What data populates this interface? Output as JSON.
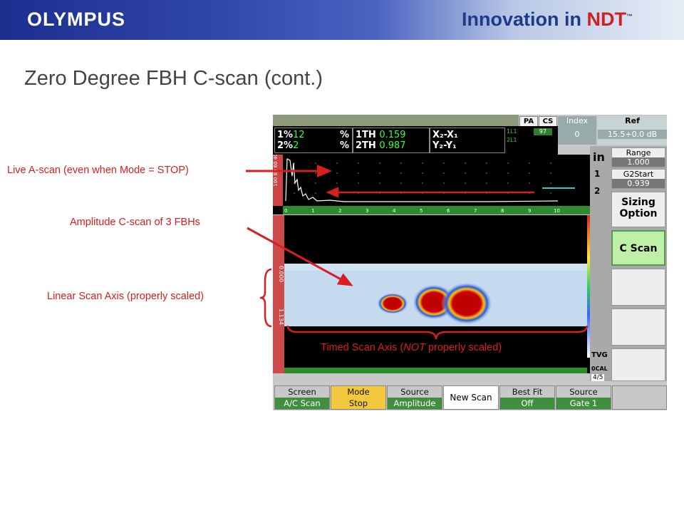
{
  "banner": {
    "logo": "OLYMPUS",
    "tagline_main": "Innovation in ",
    "tagline_accent": "NDT",
    "tagline_tm": "™"
  },
  "slide_title": "Zero Degree FBH C-scan (cont.)",
  "annotations": {
    "live_ascan": "Live A-scan (even when Mode = STOP)",
    "amplitude_cscan": "Amplitude C-scan of 3 FBHs",
    "linear_axis": "Linear Scan Axis (properly scaled)",
    "timed_axis_pre": "Timed Scan Axis (",
    "timed_axis_em": "NOT",
    "timed_axis_post": " properly scaled)"
  },
  "device": {
    "tabs": {
      "pa": "PA",
      "cs": "CS"
    },
    "readings": {
      "r1_label": "1%",
      "r1_value": "12",
      "r1_unit": "%",
      "r2_label": "2%",
      "r2_value": "2",
      "r2_unit": "%",
      "th1_label": "1TH",
      "th1_value": "0.159",
      "th2_label": "2TH",
      "th2_value": "0.987",
      "x_label": "X₂-X₁",
      "y_label": "Y₂-Y₁",
      "side1": "1L1",
      "side2": "2L1",
      "badge": "97"
    },
    "index": {
      "label": "Index",
      "value": "0"
    },
    "ref": {
      "label": "Ref",
      "value": "15.5+0.0 dB"
    },
    "units": "in",
    "gate_markers": [
      "1",
      "2"
    ],
    "range": {
      "label": "Range",
      "value": "1.000"
    },
    "g2start": {
      "label": "G2Start",
      "value": "0.939"
    },
    "y_axis_label": "100 80 60 40 20 0",
    "x_ticks": [
      "0",
      "1",
      "2",
      "3",
      "4",
      "5",
      "6",
      "7",
      "8",
      "9",
      "10"
    ],
    "cscan_axis_top": "0.000",
    "cscan_axis_bottom": "1.134",
    "side_buttons": {
      "sizing_line1": "Sizing",
      "sizing_line2": "Option",
      "cscan": "C Scan"
    },
    "tvg": "TVG",
    "cal": "0CAL",
    "page": "4/5",
    "bottom_bar": [
      {
        "top": "Screen",
        "bottom": "A/C Scan"
      },
      {
        "top": "Mode",
        "bottom": "Stop"
      },
      {
        "top": "Source",
        "bottom": "Amplitude"
      },
      {
        "top": "New Scan",
        "bottom": ""
      },
      {
        "top": "Best Fit",
        "bottom": "Off"
      },
      {
        "top": "Source",
        "bottom": "Gate 1"
      }
    ]
  },
  "colors": {
    "accent": "#d81e1e",
    "banner": "#1c2f8f",
    "screen_green": "#39ff39",
    "button_green": "#3e8f3e",
    "highlight": "#f3c83f"
  }
}
